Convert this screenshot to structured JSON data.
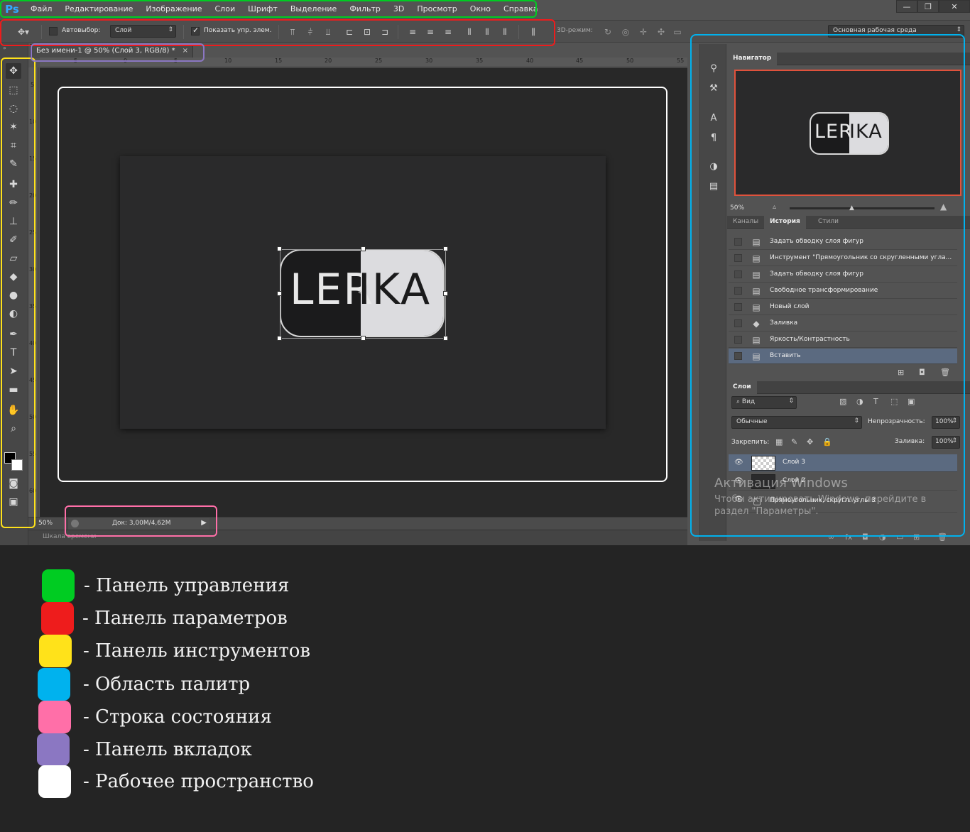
{
  "menu": {
    "logo": "Ps",
    "items": [
      "Файл",
      "Редактирование",
      "Изображение",
      "Слои",
      "Шрифт",
      "Выделение",
      "Фильтр",
      "3D",
      "Просмотр",
      "Окно",
      "Справка"
    ],
    "window_controls": [
      "—",
      "❐",
      "✕"
    ]
  },
  "options": {
    "autoselect_label": "Автовыбор:",
    "autoselect_checked": false,
    "autoselect_value": "Слой",
    "show_controls_label": "Показать упр. элем.",
    "show_controls_checked": true,
    "mode_3d_label": "3D-режим:",
    "workspace": "Основная рабочая среда"
  },
  "tab": {
    "title": "Без имени-1 @ 50% (Слой 3, RGB/8) *",
    "close": "×"
  },
  "ruler": {
    "h_labels": [
      "5",
      "0",
      "5",
      "10",
      "15",
      "20",
      "25",
      "30",
      "35",
      "40",
      "45",
      "50",
      "55"
    ],
    "v_labels": [
      "5",
      "10",
      "15",
      "20",
      "25",
      "30",
      "35",
      "40",
      "45",
      "50",
      "55",
      "60"
    ]
  },
  "canvas": {
    "logo_left": "LER",
    "logo_right": "IKA"
  },
  "status": {
    "zoom": "50%",
    "doc": "Док: 3,00M/4,62M",
    "arrow": "▶",
    "timeline": "Шкала времени"
  },
  "navigator": {
    "title": "Навигатор",
    "zoom": "50%",
    "logo_left": "LER",
    "logo_right": "IKA"
  },
  "history": {
    "tabs": [
      "Каналы",
      "История",
      "Стили"
    ],
    "active_tab": 1,
    "rows": [
      "Задать обводку слоя фигур",
      "Инструмент \"Прямоугольник со скругленными угла...",
      "Задать обводку слоя фигур",
      "Свободное трансформирование",
      "Новый слой",
      "Заливка",
      "Яркость/Контрастность",
      "Вставить"
    ],
    "selected_row": 7
  },
  "layers": {
    "title": "Слои",
    "filter": "Вид",
    "blend_mode": "Обычные",
    "opacity_label": "Непрозрачность:",
    "opacity": "100%",
    "lock_label": "Закрепить:",
    "fill_label": "Заливка:",
    "fill": "100%",
    "rows": [
      "Слой 3",
      "Слой 2",
      "Прямоугольник, скругл. углы 3"
    ],
    "selected_row": 0
  },
  "activation": {
    "title": "Активация Windows",
    "text": "Чтобы активировать Windows, перейдите в раздел \"Параметры\"."
  },
  "legend": [
    {
      "color": "#00cc22",
      "label": "- Панель управления"
    },
    {
      "color": "#ee1c1c",
      "label": "- Панель параметров"
    },
    {
      "color": "#ffe21a",
      "label": "- Панель инструментов"
    },
    {
      "color": "#00b2ee",
      "label": "- Область палитр"
    },
    {
      "color": "#ff6fa8",
      "label": "- Строка состояния"
    },
    {
      "color": "#8b77c2",
      "label": "- Панель вкладок"
    },
    {
      "color": "#ffffff",
      "label": "- Рабочее пространство"
    }
  ],
  "highlight_colors": {
    "control": "#00cc22",
    "options": "#ee1c1c",
    "tools": "#ffe21a",
    "palettes": "#00b2ee",
    "status": "#ff6fa8",
    "tabs": "#8b77c2",
    "workspace": "#ffffff"
  }
}
